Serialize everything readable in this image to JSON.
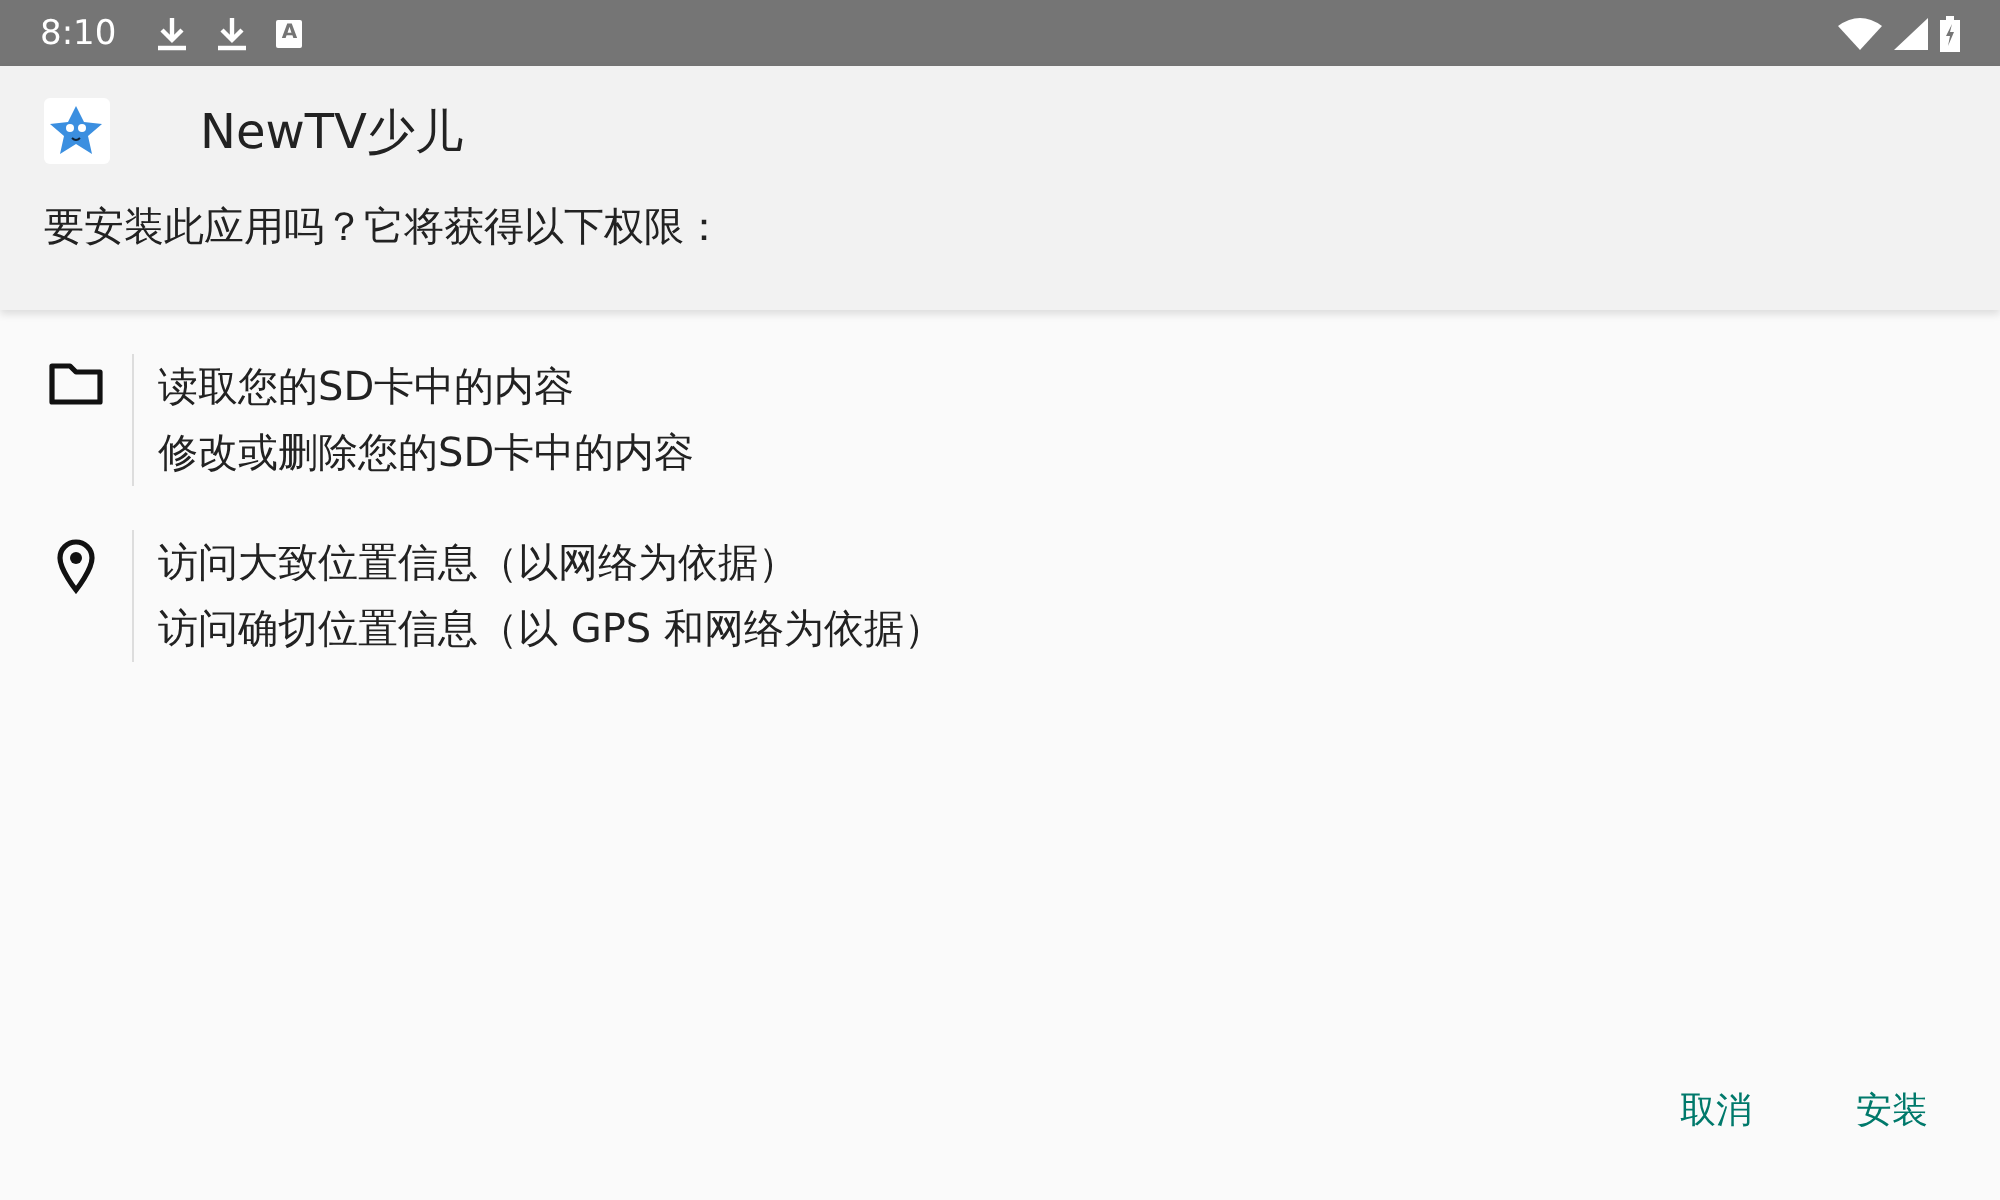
{
  "status_bar": {
    "time": "8:10",
    "notifications": [
      {
        "kind": "download"
      },
      {
        "kind": "download"
      },
      {
        "kind": "letter",
        "label": "A"
      }
    ]
  },
  "header": {
    "app_name": "NewTV少儿",
    "question": "要安装此应用吗？它将获得以下权限："
  },
  "permission_groups": [
    {
      "kind": "storage",
      "items": [
        "读取您的SD卡中的内容",
        "修改或删除您的SD卡中的内容"
      ]
    },
    {
      "kind": "location",
      "items": [
        "访问大致位置信息（以网络为依据）",
        "访问确切位置信息（以 GPS 和网络为依据）"
      ]
    }
  ],
  "buttons": [
    "取消",
    "安装"
  ]
}
